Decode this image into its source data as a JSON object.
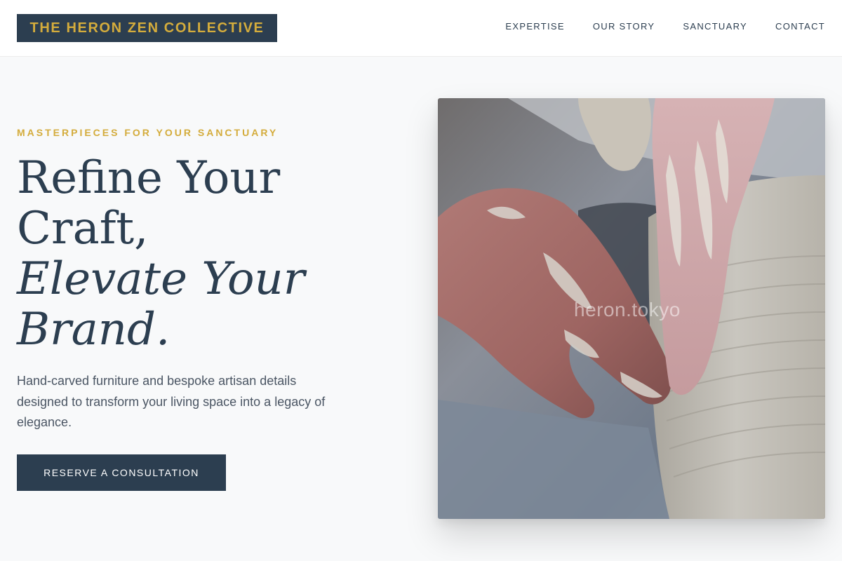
{
  "brand": {
    "name": "THE HERON ZEN COLLECTIVE"
  },
  "nav": {
    "items": [
      "EXPERTISE",
      "OUR STORY",
      "SANCTUARY",
      "CONTACT"
    ]
  },
  "hero": {
    "eyebrow": "MASTERPIECES FOR YOUR SANCTUARY",
    "headline_plain": "Refine Your Craft,",
    "headline_italic": "Elevate Your Brand.",
    "description": "Hand-carved furniture and bespoke artisan details designed to transform your living space into a legacy of elegance.",
    "cta_label": "RESERVE A CONSULTATION"
  },
  "image": {
    "subject": "hands shaping clay on a pottery wheel",
    "watermark": "heron.tokyo"
  },
  "colors": {
    "navy": "#2c3e50",
    "gold": "#d4ac3c",
    "page_bg": "#f8f9fa",
    "body_text": "#4a5563"
  }
}
